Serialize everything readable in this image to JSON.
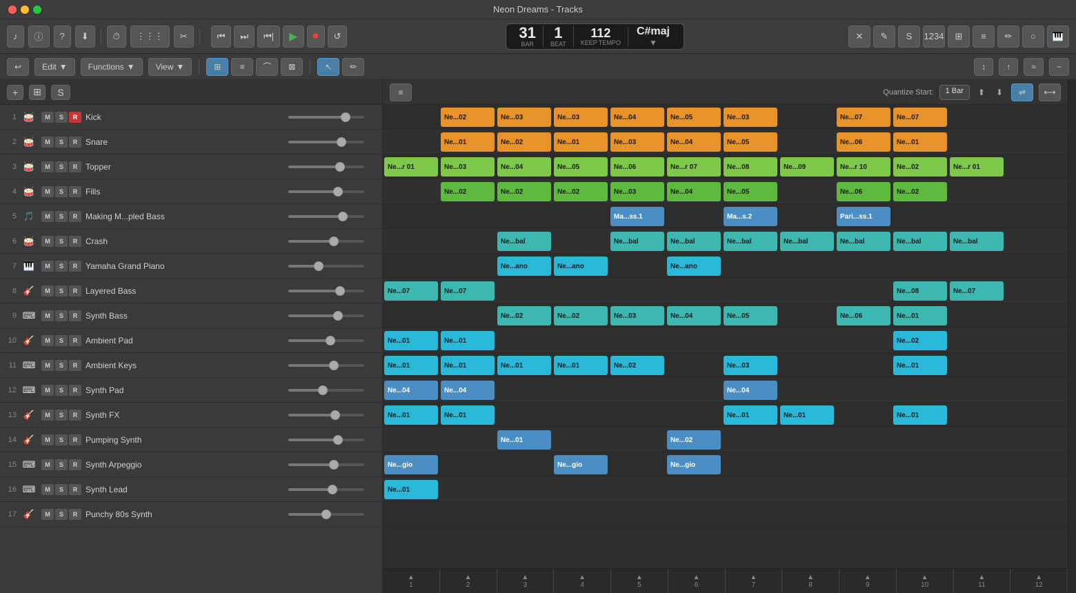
{
  "titlebar": {
    "title": "Neon Dreams - Tracks"
  },
  "transport": {
    "bar": "31",
    "beat": "1",
    "bar_label": "BAR",
    "beat_label": "BEAT",
    "tempo": "112",
    "tempo_label": "KEEP TEMPO",
    "key": "C#maj",
    "rewind_label": "⏮",
    "fast_forward_label": "⏭",
    "to_start_label": "⏮",
    "play_label": "▶",
    "record_label": "⏺",
    "cycle_label": "↺"
  },
  "edit_toolbar": {
    "edit_label": "Edit",
    "functions_label": "Functions",
    "view_label": "View"
  },
  "track_list_header": {
    "add_label": "+",
    "group_label": "⊞",
    "solo_label": "S"
  },
  "arrangement_header": {
    "quantize_label": "Quantize Start:",
    "quantize_value": "1 Bar"
  },
  "tracks": [
    {
      "num": 1,
      "name": "Kick",
      "icon": "🥁",
      "mute": false,
      "solo": false,
      "record": true,
      "fader": 75
    },
    {
      "num": 2,
      "name": "Snare",
      "icon": "🥁",
      "mute": false,
      "solo": false,
      "record": false,
      "fader": 70
    },
    {
      "num": 3,
      "name": "Topper",
      "icon": "🥁",
      "mute": false,
      "solo": false,
      "record": false,
      "fader": 68
    },
    {
      "num": 4,
      "name": "Fills",
      "icon": "🥁",
      "mute": false,
      "solo": false,
      "record": false,
      "fader": 65
    },
    {
      "num": 5,
      "name": "Making M...pled Bass",
      "icon": "🎵",
      "mute": false,
      "solo": false,
      "record": false,
      "fader": 72
    },
    {
      "num": 6,
      "name": "Crash",
      "icon": "🥁",
      "mute": false,
      "solo": false,
      "record": false,
      "fader": 60
    },
    {
      "num": 7,
      "name": "Yamaha Grand Piano",
      "icon": "🎹",
      "mute": false,
      "solo": false,
      "record": false,
      "fader": 40
    },
    {
      "num": 8,
      "name": "Layered Bass",
      "icon": "🎸",
      "mute": false,
      "solo": false,
      "record": false,
      "fader": 68
    },
    {
      "num": 9,
      "name": "Synth Bass",
      "icon": "⌨",
      "mute": false,
      "solo": false,
      "record": false,
      "fader": 65
    },
    {
      "num": 10,
      "name": "Ambient Pad",
      "icon": "🎸",
      "mute": false,
      "solo": false,
      "record": false,
      "fader": 55
    },
    {
      "num": 11,
      "name": "Ambient Keys",
      "icon": "⌨",
      "mute": false,
      "solo": false,
      "record": false,
      "fader": 60
    },
    {
      "num": 12,
      "name": "Synth Pad",
      "icon": "⌨",
      "mute": false,
      "solo": false,
      "record": false,
      "fader": 45
    },
    {
      "num": 13,
      "name": "Synth FX",
      "icon": "🎸",
      "mute": false,
      "solo": false,
      "record": false,
      "fader": 62
    },
    {
      "num": 14,
      "name": "Pumping Synth",
      "icon": "🎸",
      "mute": false,
      "solo": false,
      "record": false,
      "fader": 65
    },
    {
      "num": 15,
      "name": "Synth Arpeggio",
      "icon": "⌨",
      "mute": false,
      "solo": false,
      "record": false,
      "fader": 60
    },
    {
      "num": 16,
      "name": "Synth Lead",
      "icon": "⌨",
      "mute": false,
      "solo": false,
      "record": false,
      "fader": 58
    },
    {
      "num": 17,
      "name": "Punchy 80s Synth",
      "icon": "🎸",
      "mute": false,
      "solo": false,
      "record": false,
      "fader": 50
    }
  ],
  "ruler": {
    "markers": [
      "1",
      "2",
      "3",
      "4",
      "5",
      "6",
      "7",
      "8",
      "9",
      "10",
      "11",
      "12"
    ]
  }
}
